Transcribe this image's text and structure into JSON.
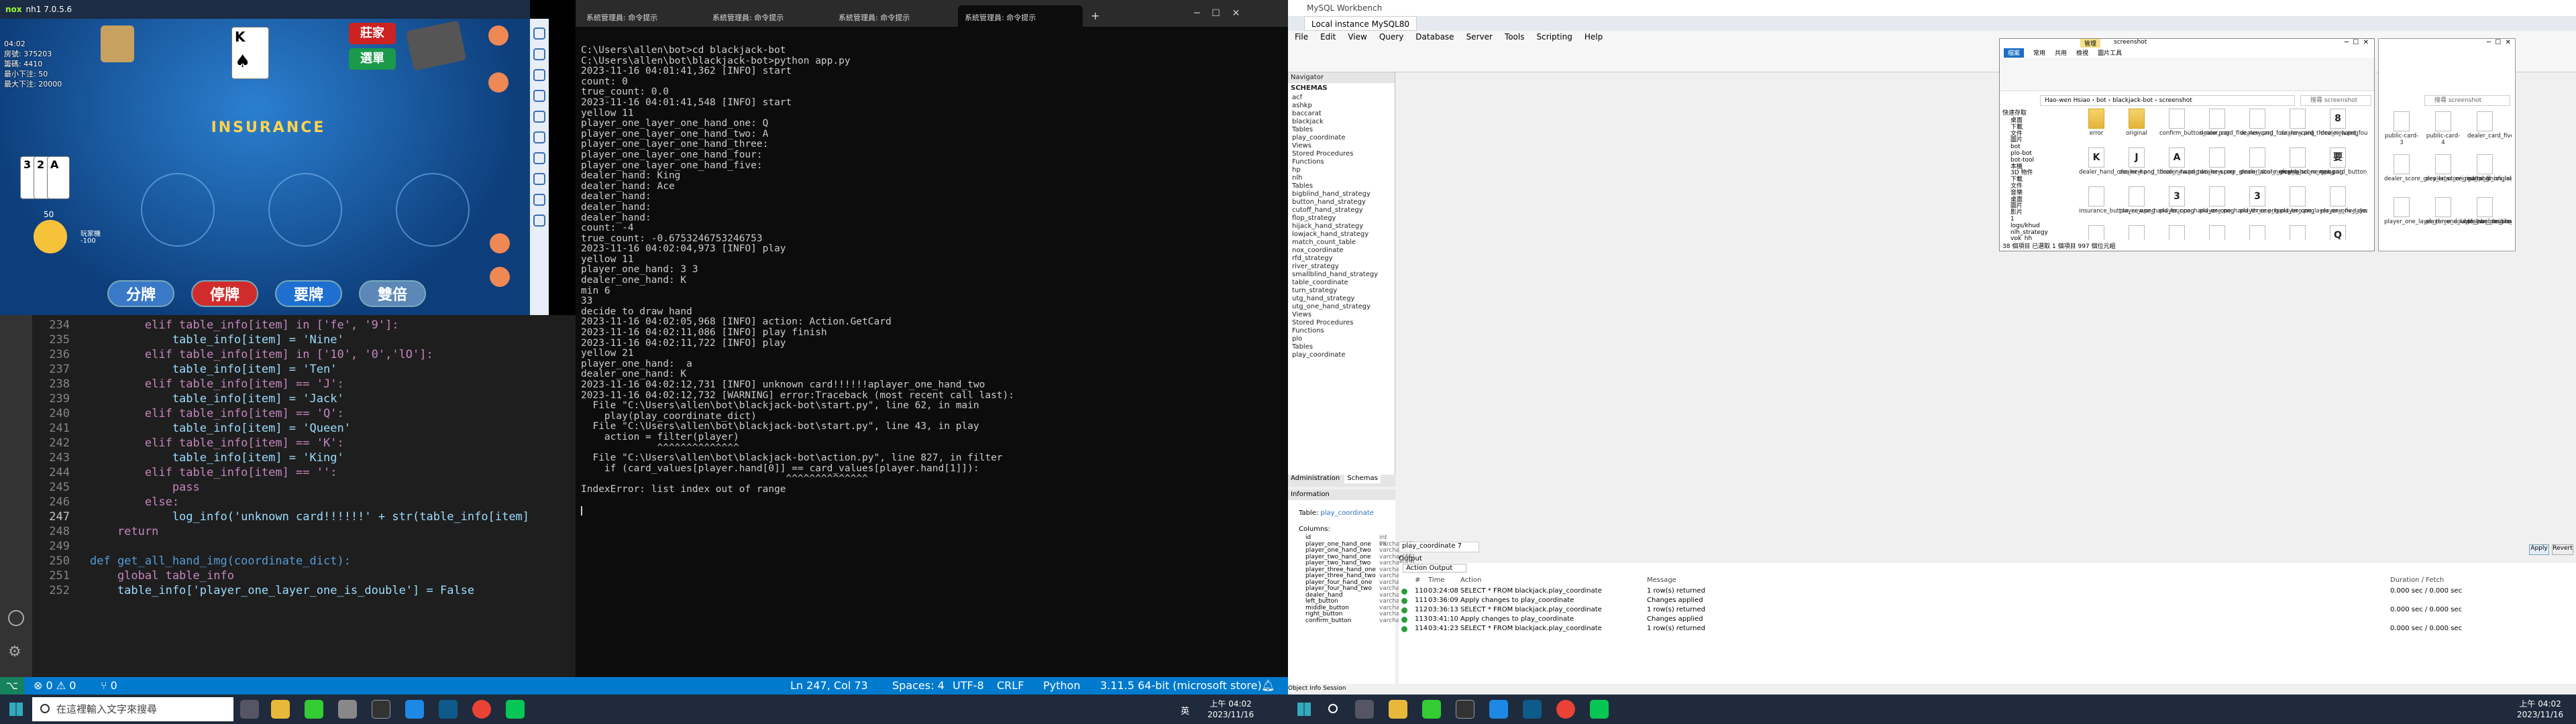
{
  "nox": {
    "title": "nh1 7.0.5.6",
    "stats": [
      "04:02",
      "房號: 375203",
      "籌碼: 4410",
      "最小下注: 50",
      "最大下注: 20000"
    ],
    "btn_banker": "莊家",
    "btn_menu": "選單",
    "btn_split": "分牌",
    "btn_stand": "停牌",
    "btn_hit": "要牌",
    "btn_double": "雙倍",
    "insurance": "INSURANCE",
    "player_cards": [
      "3",
      "2",
      "A"
    ],
    "dealer_card": "K",
    "bet": "50",
    "min_label": "-100",
    "player_name": "玩家機"
  },
  "terminal": {
    "tabs": [
      "系統管理員: 命令提示",
      "系統管理員: 命令提示",
      "系統管理員: 命令提示",
      "系統管理員: 命令提示"
    ],
    "new_tab": "+",
    "lines": [
      "C:\\Users\\allen\\bot>cd blackjack-bot",
      "",
      "C:\\Users\\allen\\bot\\blackjack-bot>python app.py",
      "2023-11-16 04:01:41,362 [INFO] start",
      "count: 0",
      "true_count: 0.0",
      "2023-11-16 04:01:41,548 [INFO] start",
      "yellow 11",
      "player_one_layer_one_hand_one: Q",
      "player_one_layer_one_hand_two: A",
      "player_one_layer_one_hand_three:",
      "player_one_layer_one_hand_four:",
      "player_one_layer_one_hand_five:",
      "dealer_hand: King",
      "dealer_hand: Ace",
      "dealer_hand:",
      "dealer_hand:",
      "dealer_hand:",
      "count: -4",
      "true_count: -0.6753246753246753",
      "2023-11-16 04:02:04,973 [INFO] play",
      "yellow 11",
      "player_one_hand: 3 3",
      "dealer_one_hand: K",
      "min 6",
      "33",
      "decide to draw hand",
      "2023-11-16 04:02:05,968 [INFO] action: Action.GetCard",
      "2023-11-16 04:02:11,086 [INFO] play finish",
      "2023-11-16 04:02:11,722 [INFO] play",
      "yellow 21",
      "player_one_hand:  a",
      "dealer_one_hand: K",
      "2023-11-16 04:02:12,731 [INFO] unknown card!!!!!!aplayer_one_hand_two",
      "2023-11-16 04:02:12,732 [WARNING] error:Traceback (most recent call last):",
      "  File \"C:\\Users\\allen\\bot\\blackjack-bot\\start.py\", line 62, in main",
      "    play(play_coordinate_dict)",
      "  File \"C:\\Users\\allen\\bot\\blackjack-bot\\start.py\", line 43, in play",
      "    action = filter(player)",
      "             ^^^^^^^^^^^^^^",
      "  File \"C:\\Users\\allen\\bot\\blackjack-bot\\action.py\", line 827, in filter",
      "    if (card_values[player.hand[0]] == card_values[player.hand[1]]):",
      "                                   ^^^^^^^^^^^^^^",
      "IndexError: list index out of range"
    ]
  },
  "editor": {
    "lines": [
      {
        "n": "234",
        "c": "        elif table_info[item] in ['fe', '9']:"
      },
      {
        "n": "235",
        "c": "            table_info[item] = 'Nine'"
      },
      {
        "n": "236",
        "c": "        elif table_info[item] in ['10', '0','lO']:"
      },
      {
        "n": "237",
        "c": "            table_info[item] = 'Ten'"
      },
      {
        "n": "238",
        "c": "        elif table_info[item] == 'J':"
      },
      {
        "n": "239",
        "c": "            table_info[item] = 'Jack'"
      },
      {
        "n": "240",
        "c": "        elif table_info[item] == 'Q':"
      },
      {
        "n": "241",
        "c": "            table_info[item] = 'Queen'"
      },
      {
        "n": "242",
        "c": "        elif table_info[item] == 'K':"
      },
      {
        "n": "243",
        "c": "            table_info[item] = 'King'"
      },
      {
        "n": "244",
        "c": "        elif table_info[item] == '':"
      },
      {
        "n": "245",
        "c": "            pass"
      },
      {
        "n": "246",
        "c": "        else:"
      },
      {
        "n": "247",
        "c": "            log_info('unknown card!!!!!!' + str(table_info[item]"
      },
      {
        "n": "248",
        "c": "    return"
      },
      {
        "n": "249",
        "c": ""
      },
      {
        "n": "250",
        "c": "def get_all_hand_img(coordinate_dict):"
      },
      {
        "n": "251",
        "c": "    global table_info"
      },
      {
        "n": "252",
        "c": "    table_info['player_one_layer_one_is_double'] = False"
      }
    ]
  },
  "statusbar": {
    "errors": "⊗ 0 ⚠ 0",
    "ports": "⑂ 0",
    "position": "Ln 247, Col 73",
    "spaces": "Spaces: 4",
    "encoding": "UTF-8",
    "eol": "CRLF",
    "language": "Python",
    "interpreter": "3.11.5 64-bit (microsoft store)"
  },
  "taskbar_left": {
    "search": "在這裡輸入文字來搜尋"
  },
  "workbench": {
    "title": "MySQL Workbench",
    "tab": "Local instance MySQL80",
    "menu": [
      "File",
      "Edit",
      "View",
      "Query",
      "Database",
      "Server",
      "Tools",
      "Scripting",
      "Help"
    ],
    "navigator": "Navigator",
    "schemas": "SCHEMAS",
    "tree": [
      "acf",
      "ashkp",
      "baccarat",
      "blackjack",
      "Tables",
      "play_coordinate",
      "Views",
      "Stored Procedures",
      "Functions",
      "hp",
      "nlh",
      "Tables",
      "bigblind_hand_strategy",
      "button_hand_strategy",
      "cutoff_hand_strategy",
      "flop_strategy",
      "hijack_hand_strategy",
      "lowjack_hand_strategy",
      "match_count_table",
      "nox_coordinate",
      "rfd_strategy",
      "river_strategy",
      "smallblind_hand_strategy",
      "table_coordinate",
      "turn_strategy",
      "utg_hand_strategy",
      "utg_one_hand_strategy",
      "Views",
      "Stored Procedures",
      "Functions",
      "plo",
      "Tables",
      "play_coordinate"
    ],
    "admin_tab": "Administration",
    "schemas_tab": "Schemas",
    "info": "Information",
    "table_label": "Table:",
    "table_name": "play_coordinate",
    "columns_label": "Columns:",
    "columns": [
      "id",
      "player_one_hand_one",
      "player_one_hand_two",
      "player_two_hand_one",
      "player_two_hand_two",
      "player_three_hand_one",
      "player_three_hand_two",
      "player_four_hand_one",
      "player_four_hand_two",
      "dealer_hand",
      "left_button",
      "middle_button",
      "right_button",
      "confirm_button"
    ],
    "col_types": [
      "int PK",
      "varchar(45)",
      "varchar(45)",
      "varchar(45)",
      "varchar(45)",
      "varchar(45)",
      "varchar(45)",
      "varchar(45)",
      "varchar(45)",
      "varchar(45)",
      "varchar(45)",
      "varchar(45)",
      "varchar(45)",
      "varchar(45)"
    ],
    "object_info": "Object Info",
    "session": "Session",
    "output_label": "Output",
    "action_output": "Action Output",
    "query_tab": "play_coordinate 7",
    "output_headers": [
      "#",
      "Time",
      "Action",
      "Message",
      "Duration / Fetch"
    ],
    "output_rows": [
      {
        "n": "110",
        "t": "03:24:08",
        "a": "SELECT * FROM blackjack.play_coordinate",
        "m": "1 row(s) returned",
        "d": "0.000 sec / 0.000 sec"
      },
      {
        "n": "111",
        "t": "03:36:09",
        "a": "Apply changes to play_coordinate",
        "m": "Changes applied",
        "d": ""
      },
      {
        "n": "112",
        "t": "03:36:13",
        "a": "SELECT * FROM blackjack.play_coordinate",
        "m": "1 row(s) returned",
        "d": "0.000 sec / 0.000 sec"
      },
      {
        "n": "113",
        "t": "03:41:10",
        "a": "Apply changes to play_coordinate",
        "m": "Changes applied",
        "d": ""
      },
      {
        "n": "114",
        "t": "03:41:23",
        "a": "SELECT * FROM blackjack.play_coordinate",
        "m": "1 row(s) returned",
        "d": "0.000 sec / 0.000 sec"
      }
    ],
    "apply": "Apply",
    "revert": "Revert"
  },
  "explorer": {
    "ribbon_tabs": [
      "檔案",
      "常用",
      "共用",
      "檢視",
      "圖片工具"
    ],
    "manage": "管理",
    "folder": "screenshot",
    "path": [
      "Hao-wen Hsiao",
      "bot",
      "blackjack-bot",
      "screenshot"
    ],
    "search": "搜尋 screenshot",
    "quick": "快速存取",
    "nav": [
      "桌面",
      "下載",
      "文件",
      "圖片",
      "bot",
      "plo-bot",
      "bot-tool",
      "本機",
      "3D 物件",
      "下載",
      "文件",
      "音樂",
      "桌面",
      "圖片",
      "影片",
      "1",
      "logs/khud",
      "nlh_strategy",
      "vpk_hh"
    ],
    "status": "38 個項目    已選取 1 個項目 997 個位元組",
    "files": [
      {
        "n": "error",
        "t": "folder",
        "g": ""
      },
      {
        "n": "original",
        "t": "folder",
        "g": ""
      },
      {
        "n": "confirm_button_new.png",
        "t": "img",
        "g": ""
      },
      {
        "n": "dealer_card_five_new.png",
        "t": "img",
        "g": ""
      },
      {
        "n": "dealer_card_four_new.png",
        "t": "img",
        "g": ""
      },
      {
        "n": "dealer_card_three_new.png",
        "t": "img",
        "g": ""
      },
      {
        "n": "dealer_hand_four_new.png",
        "t": "img",
        "g": "8"
      },
      {
        "n": "dealer_hand_one_new.png",
        "t": "img",
        "g": "K"
      },
      {
        "n": "dealer_hand_three_new.png",
        "t": "img",
        "g": "J"
      },
      {
        "n": "dealer_hand_two_new.png",
        "t": "img",
        "g": "A"
      },
      {
        "n": "dealer_score_green_label_new.png",
        "t": "img",
        "g": ""
      },
      {
        "n": "dealer_score_grey_label_new.png",
        "t": "img",
        "g": ""
      },
      {
        "n": "dealer_score_new.png",
        "t": "img",
        "g": ""
      },
      {
        "n": "get_card_button_new.png",
        "t": "img",
        "g": "要"
      },
      {
        "n": "insurance_button_new.png",
        "t": "img",
        "g": ""
      },
      {
        "n": "player_one_hand_four.png",
        "t": "img",
        "g": ""
      },
      {
        "n": "player_one_hand_one.png",
        "t": "img",
        "g": "3"
      },
      {
        "n": "player_one_hand_three.png",
        "t": "img",
        "g": ""
      },
      {
        "n": "player_one_hand_two.png",
        "t": "img",
        "g": "3"
      },
      {
        "n": "player_one_layer_one_five_double_label_new.png",
        "t": "img",
        "g": ""
      },
      {
        "n": "player_one_layer_one_four_double_label_new.png",
        "t": "img",
        "g": ""
      },
      {
        "n": "player_one_layer_one_card_five_new.png",
        "t": "img",
        "g": ""
      },
      {
        "n": "player_one_layer_one_card_four_new.png",
        "t": "img",
        "g": ""
      },
      {
        "n": "player_one_layer_one_card_three_new.png",
        "t": "img",
        "g": ""
      },
      {
        "n": "player_one_layer_one_double_label_new.png",
        "t": "img",
        "g": ""
      },
      {
        "n": "player_one_layer_one_hand_five_new.png",
        "t": "img",
        "g": ""
      },
      {
        "n": "player_one_layer_one_hand_four_new.png",
        "t": "img",
        "g": ""
      },
      {
        "n": "player_one_layer_one_hand_one_new.png",
        "t": "img",
        "g": "Q"
      }
    ],
    "files2": [
      {
        "n": "public-card-3",
        "t": "img",
        "g": ""
      },
      {
        "n": "public-card-4",
        "t": "img",
        "g": ""
      },
      {
        "n": "dealer_card_five_original.png",
        "t": "img",
        "g": ""
      },
      {
        "n": "dealer_score_grey_label_original.png",
        "t": "img",
        "g": ""
      },
      {
        "n": "dealer_score_red_label_original.png",
        "t": "img",
        "g": ""
      },
      {
        "n": "game_finish_label_original.png",
        "t": "img",
        "g": ""
      },
      {
        "n": "player_one_layer_three_double_label_original.png",
        "t": "img",
        "g": ""
      },
      {
        "n": "player_one_layer_two_double_label_original.png",
        "t": "img",
        "g": ""
      },
      {
        "n": "player_one_score_green_label_original.png",
        "t": "img",
        "g": ""
      }
    ],
    "search2": "搜尋 screenshot"
  },
  "clock": {
    "time": "上午 04:02",
    "date": "2023/11/16",
    "ime": "英"
  }
}
